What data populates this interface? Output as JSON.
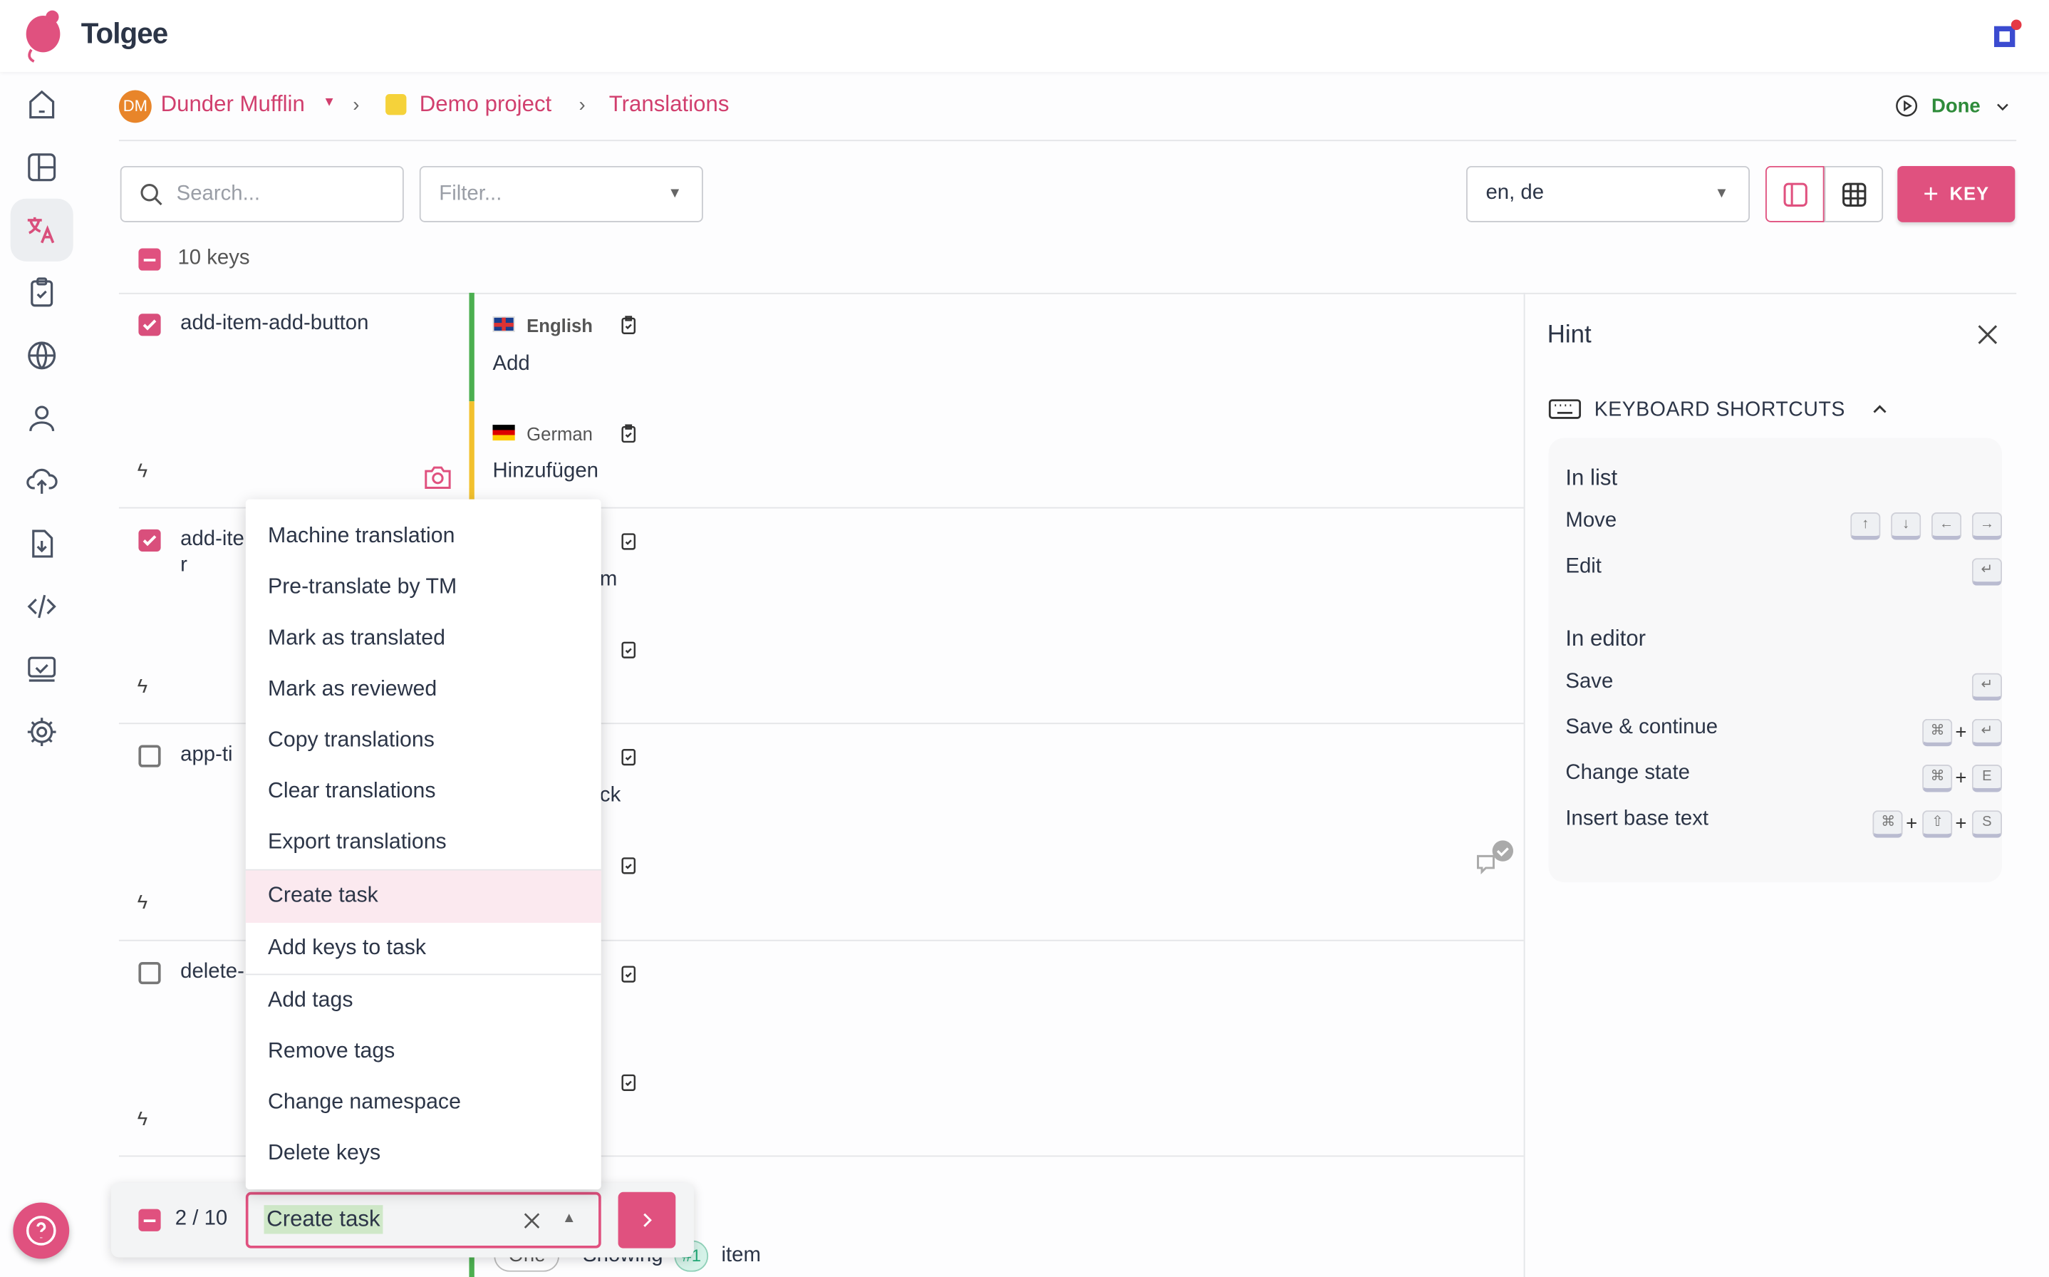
{
  "app": {
    "name": "Tolgee"
  },
  "colors": {
    "accent": "#d94f7c",
    "done": "#2e8b3a",
    "english_bar": "#4caf50",
    "german_bar": "#f2c12e"
  },
  "sidebar": {
    "items": [
      {
        "icon": "home-icon"
      },
      {
        "icon": "dashboard-icon"
      },
      {
        "icon": "translate-icon",
        "active": true
      },
      {
        "icon": "tasks-icon"
      },
      {
        "icon": "globe-icon"
      },
      {
        "icon": "user-icon"
      },
      {
        "icon": "upload-icon"
      },
      {
        "icon": "download-icon"
      },
      {
        "icon": "code-icon"
      },
      {
        "icon": "review-icon"
      },
      {
        "icon": "settings-icon"
      }
    ],
    "help_icon": "help-icon"
  },
  "breadcrumb": {
    "org_initials": "DM",
    "org": "Dunder Mufflin",
    "project": "Demo project",
    "page": "Translations"
  },
  "header": {
    "status": "Done"
  },
  "toolbar": {
    "search_placeholder": "Search...",
    "filter_placeholder": "Filter...",
    "languages": "en, de",
    "add_key": "KEY"
  },
  "list": {
    "count": "10 keys",
    "rows": [
      {
        "key": "add-item-add-button",
        "checked": true,
        "en_label": "English",
        "en_text": "Add",
        "de_label": "German",
        "de_text": "Hinzufügen"
      },
      {
        "key": "add-ite",
        "key2": "r",
        "checked": true,
        "en_text": "m"
      },
      {
        "key": "app-ti",
        "checked": false,
        "en_text": "ck"
      },
      {
        "key": "delete-",
        "checked": false
      }
    ],
    "last_row": {
      "chip1": "One",
      "text1": "Showing",
      "chip2": "#1",
      "text2": "item"
    }
  },
  "menu": {
    "items": [
      "Machine translation",
      "Pre-translate by TM",
      "Mark as translated",
      "Mark as reviewed",
      "Copy translations",
      "Clear translations",
      "Export translations",
      "Create task",
      "Add keys to task",
      "Add tags",
      "Remove tags",
      "Change namespace",
      "Delete keys"
    ],
    "selected": "Create task"
  },
  "bulk": {
    "count": "2 / 10",
    "value": "Create task"
  },
  "hint": {
    "title": "Hint",
    "section": "KEYBOARD SHORTCUTS",
    "in_list": "In list",
    "move": "Move",
    "edit": "Edit",
    "in_editor": "In editor",
    "save": "Save",
    "save_continue": "Save & continue",
    "change_state": "Change state",
    "insert_base": "Insert base text",
    "keys": {
      "up": "↑",
      "down": "↓",
      "left": "←",
      "right": "→",
      "enter": "↵",
      "cmd": "⌘",
      "plus": "+",
      "e": "E",
      "shift": "⇧",
      "s": "S"
    }
  }
}
